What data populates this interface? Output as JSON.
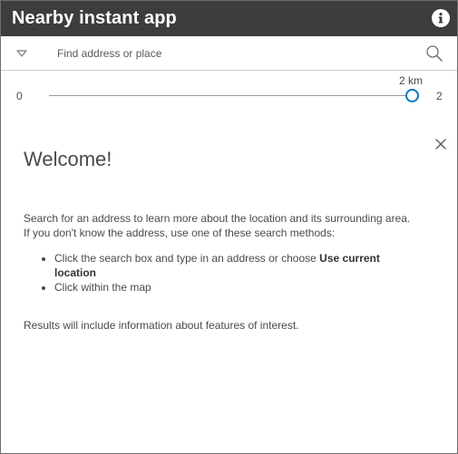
{
  "header": {
    "title": "Nearby instant app",
    "info_icon": "info-icon"
  },
  "search": {
    "placeholder": "Find address or place",
    "value": "",
    "dropdown_icon": "chevron-down-icon",
    "search_icon": "search-icon"
  },
  "slider": {
    "min_label": "0",
    "max_label": "2",
    "value_label": "2 km",
    "value": 2,
    "accent_color": "#007ac2"
  },
  "panel": {
    "close_icon": "close-icon",
    "heading": "Welcome!",
    "intro_line1": "Search for an address to learn more about the location and its surrounding area.",
    "intro_line2": "If you don't know the address, use one of these search methods:",
    "bullet1_prefix": "Click the search box and type in an address or choose ",
    "bullet1_bold": "Use current location",
    "bullet2": "Click within the map",
    "results_text": "Results will include information about features of interest."
  },
  "colors": {
    "header_bg": "#3d3d3d",
    "header_text": "#ffffff",
    "body_text": "#4a4a4a"
  }
}
